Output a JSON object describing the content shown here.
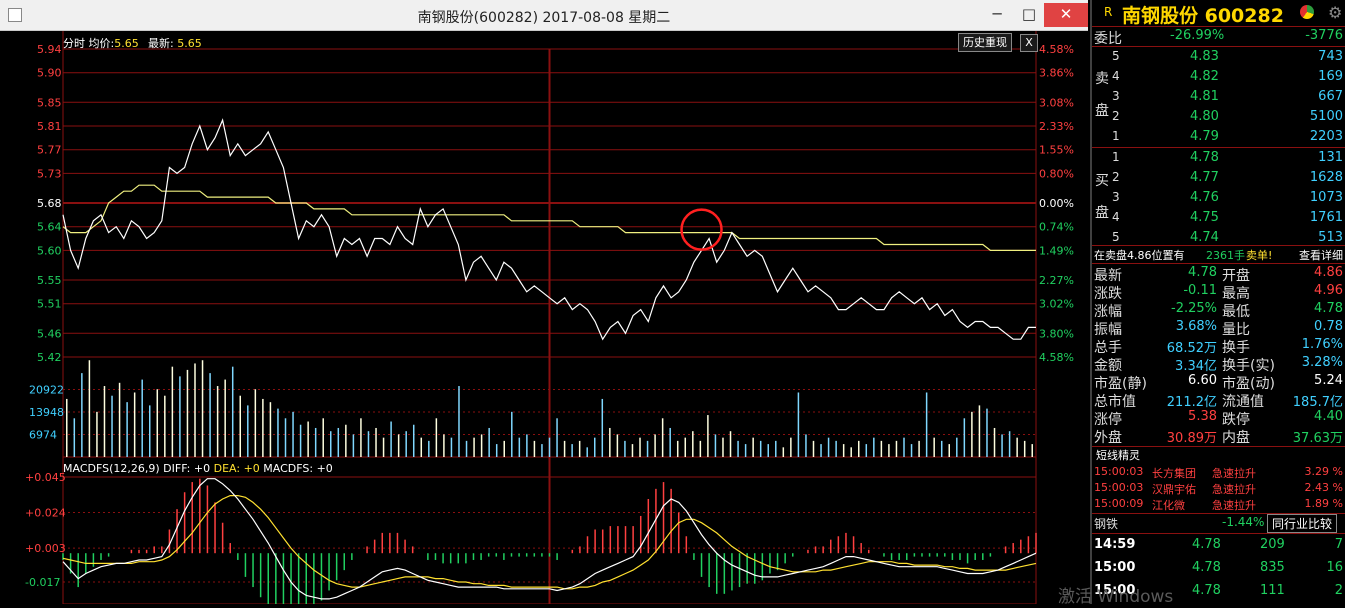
{
  "window": {
    "title": "南钢股份(600282) 2017-08-08 星期二",
    "minimize": "─",
    "maximize": "□",
    "close": "✕"
  },
  "chart_header": {
    "label": "分时 均价:",
    "avg_value": "5.65",
    "latest_label": "最新:",
    "latest_value": "5.65",
    "history_button": "历史重现",
    "close_button": "X"
  },
  "macd_header": {
    "label": "MACDFS(12,26,9)",
    "diff_label": "DIFF: +0",
    "dea_label": "DEA: +0",
    "macd_label": "MACDFS: +0"
  },
  "colors": {
    "up": "#ff4040",
    "down": "#20d060",
    "price_line": "#ffffff",
    "avg_line": "#f0f080",
    "grid": "#8a1010",
    "volume": "#80d8ff"
  },
  "chart_data": [
    {
      "type": "line",
      "name": "price",
      "y_ticks": [
        "5.94",
        "5.90",
        "5.85",
        "5.81",
        "5.77",
        "5.73",
        "5.68",
        "5.64",
        "5.60",
        "5.55",
        "5.51",
        "5.46",
        "5.42"
      ],
      "pct_ticks": [
        "4.58%",
        "3.86%",
        "3.08%",
        "2.33%",
        "1.55%",
        "0.80%",
        "0.00%",
        "0.74%",
        "1.49%",
        "2.27%",
        "3.02%",
        "3.80%",
        "4.58%"
      ],
      "ylim": [
        5.42,
        5.94
      ],
      "prev_close": 5.68,
      "price": [
        5.66,
        5.6,
        5.57,
        5.62,
        5.65,
        5.66,
        5.63,
        5.64,
        5.62,
        5.65,
        5.64,
        5.62,
        5.63,
        5.65,
        5.74,
        5.73,
        5.74,
        5.78,
        5.81,
        5.77,
        5.79,
        5.82,
        5.76,
        5.78,
        5.76,
        5.77,
        5.78,
        5.8,
        5.77,
        5.74,
        5.68,
        5.62,
        5.65,
        5.64,
        5.66,
        5.64,
        5.59,
        5.62,
        5.61,
        5.62,
        5.59,
        5.62,
        5.62,
        5.61,
        5.64,
        5.62,
        5.61,
        5.67,
        5.64,
        5.66,
        5.67,
        5.64,
        5.61,
        5.55,
        5.58,
        5.59,
        5.57,
        5.55,
        5.58,
        5.57,
        5.55,
        5.53,
        5.54,
        5.53,
        5.52,
        5.51,
        5.52,
        5.5,
        5.51,
        5.5,
        5.48,
        5.45,
        5.47,
        5.48,
        5.46,
        5.49,
        5.5,
        5.48,
        5.52,
        5.54,
        5.52,
        5.53,
        5.55,
        5.58,
        5.6,
        5.62,
        5.58,
        5.6,
        5.63,
        5.61,
        5.59,
        5.6,
        5.59,
        5.56,
        5.53,
        5.55,
        5.57,
        5.55,
        5.53,
        5.54,
        5.53,
        5.52,
        5.5,
        5.5,
        5.51,
        5.52,
        5.51,
        5.5,
        5.5,
        5.52,
        5.53,
        5.52,
        5.51,
        5.52,
        5.5,
        5.51,
        5.49,
        5.5,
        5.48,
        5.47,
        5.48,
        5.48,
        5.47,
        5.47,
        5.46,
        5.45,
        5.45,
        5.47,
        5.47
      ],
      "avg": [
        5.64,
        5.63,
        5.63,
        5.63,
        5.64,
        5.65,
        5.68,
        5.69,
        5.7,
        5.7,
        5.71,
        5.71,
        5.71,
        5.7,
        5.7,
        5.7,
        5.7,
        5.7,
        5.7,
        5.69,
        5.69,
        5.69,
        5.69,
        5.69,
        5.69,
        5.69,
        5.69,
        5.69,
        5.68,
        5.68,
        5.68,
        5.68,
        5.68,
        5.67,
        5.67,
        5.67,
        5.67,
        5.67,
        5.66,
        5.66,
        5.66,
        5.66,
        5.66,
        5.66,
        5.66,
        5.66,
        5.66,
        5.66,
        5.66,
        5.66,
        5.66,
        5.66,
        5.66,
        5.66,
        5.66,
        5.66,
        5.66,
        5.66,
        5.66,
        5.65,
        5.65,
        5.65,
        5.65,
        5.65,
        5.65,
        5.65,
        5.65,
        5.65,
        5.64,
        5.64,
        5.64,
        5.64,
        5.64,
        5.64,
        5.63,
        5.63,
        5.63,
        5.63,
        5.63,
        5.63,
        5.63,
        5.63,
        5.63,
        5.63,
        5.63,
        5.63,
        5.63,
        5.63,
        5.63,
        5.62,
        5.62,
        5.62,
        5.62,
        5.62,
        5.62,
        5.62,
        5.62,
        5.62,
        5.62,
        5.62,
        5.62,
        5.62,
        5.62,
        5.62,
        5.62,
        5.62,
        5.62,
        5.62,
        5.61,
        5.61,
        5.61,
        5.61,
        5.61,
        5.61,
        5.61,
        5.61,
        5.61,
        5.61,
        5.61,
        5.61,
        5.61,
        5.61,
        5.6,
        5.6,
        5.6,
        5.6,
        5.6,
        5.6,
        5.6
      ]
    },
    {
      "type": "bar",
      "name": "volume",
      "y_ticks": [
        "20922",
        "13948",
        "6974"
      ],
      "ylim": [
        0,
        31000
      ],
      "values": [
        18000,
        12000,
        26000,
        30000,
        14000,
        22000,
        19000,
        23000,
        17000,
        20000,
        24000,
        16000,
        21000,
        19000,
        28000,
        25000,
        27000,
        29000,
        30000,
        26000,
        22000,
        24000,
        28000,
        19000,
        16000,
        21000,
        18000,
        17000,
        15000,
        12000,
        14000,
        10000,
        11000,
        9000,
        12000,
        8000,
        9000,
        10000,
        7000,
        12000,
        8000,
        9000,
        6000,
        11000,
        7000,
        8000,
        10000,
        6000,
        5000,
        12000,
        7000,
        6000,
        22000,
        5000,
        6000,
        7000,
        9000,
        4000,
        5000,
        14000,
        6000,
        7000,
        5000,
        4000,
        6000,
        12000,
        5000,
        4000,
        5000,
        3000,
        6000,
        18000,
        9000,
        7000,
        5000,
        4000,
        6000,
        5000,
        7000,
        12000,
        9000,
        5000,
        6000,
        8000,
        5000,
        13000,
        7000,
        6000,
        8000,
        5000,
        4000,
        6000,
        5000,
        4000,
        5000,
        3000,
        6000,
        20000,
        7000,
        5000,
        4000,
        6000,
        5000,
        4000,
        3000,
        5000,
        4000,
        6000,
        5000,
        4000,
        5000,
        6000,
        4000,
        5000,
        20000,
        6000,
        5000,
        4000,
        6000,
        12000,
        14000,
        16000,
        15000,
        9000,
        7000,
        8000,
        6000,
        5000,
        4000
      ]
    },
    {
      "type": "line",
      "name": "macd",
      "y_ticks": [
        "+0.045",
        "+0.024",
        "+0.003",
        "-0.017"
      ],
      "ylim": [
        -0.03,
        0.045
      ],
      "diff": [
        -0.005,
        -0.01,
        -0.015,
        -0.012,
        -0.01,
        -0.008,
        -0.007,
        -0.006,
        -0.006,
        -0.005,
        -0.004,
        -0.004,
        -0.003,
        -0.002,
        0.005,
        0.015,
        0.025,
        0.033,
        0.04,
        0.044,
        0.044,
        0.041,
        0.037,
        0.032,
        0.026,
        0.02,
        0.013,
        0.006,
        -0.002,
        -0.01,
        -0.017,
        -0.022,
        -0.025,
        -0.026,
        -0.027,
        -0.027,
        -0.026,
        -0.024,
        -0.022,
        -0.02,
        -0.017,
        -0.014,
        -0.011,
        -0.01,
        -0.009,
        -0.01,
        -0.012,
        -0.014,
        -0.016,
        -0.017,
        -0.018,
        -0.019,
        -0.02,
        -0.02,
        -0.02,
        -0.02,
        -0.02,
        -0.02,
        -0.021,
        -0.021,
        -0.021,
        -0.021,
        -0.021,
        -0.021,
        -0.021,
        -0.022,
        -0.021,
        -0.02,
        -0.018,
        -0.015,
        -0.012,
        -0.01,
        -0.008,
        -0.006,
        -0.004,
        -0.002,
        0.004,
        0.012,
        0.02,
        0.028,
        0.032,
        0.03,
        0.025,
        0.018,
        0.011,
        0.005,
        0.0,
        -0.004,
        -0.007,
        -0.009,
        -0.011,
        -0.013,
        -0.014,
        -0.014,
        -0.014,
        -0.013,
        -0.012,
        -0.011,
        -0.01,
        -0.009,
        -0.008,
        -0.006,
        -0.004,
        -0.002,
        -0.002,
        -0.003,
        -0.004,
        -0.005,
        -0.006,
        -0.007,
        -0.008,
        -0.008,
        -0.008,
        -0.008,
        -0.008,
        -0.008,
        -0.009,
        -0.01,
        -0.011,
        -0.012,
        -0.012,
        -0.012,
        -0.011,
        -0.01,
        -0.008,
        -0.006,
        -0.004,
        -0.002,
        0.0
      ],
      "dea": [
        -0.003,
        -0.004,
        -0.005,
        -0.006,
        -0.006,
        -0.006,
        -0.006,
        -0.006,
        -0.006,
        -0.006,
        -0.005,
        -0.005,
        -0.005,
        -0.004,
        -0.002,
        0.002,
        0.007,
        0.012,
        0.018,
        0.024,
        0.029,
        0.032,
        0.034,
        0.034,
        0.033,
        0.03,
        0.026,
        0.021,
        0.015,
        0.009,
        0.003,
        -0.002,
        -0.006,
        -0.01,
        -0.013,
        -0.016,
        -0.018,
        -0.019,
        -0.02,
        -0.02,
        -0.019,
        -0.018,
        -0.017,
        -0.016,
        -0.015,
        -0.014,
        -0.014,
        -0.014,
        -0.014,
        -0.015,
        -0.015,
        -0.016,
        -0.017,
        -0.017,
        -0.018,
        -0.018,
        -0.019,
        -0.019,
        -0.019,
        -0.02,
        -0.02,
        -0.02,
        -0.02,
        -0.02,
        -0.02,
        -0.02,
        -0.021,
        -0.021,
        -0.02,
        -0.02,
        -0.019,
        -0.017,
        -0.016,
        -0.014,
        -0.012,
        -0.01,
        -0.007,
        -0.004,
        0.001,
        0.007,
        0.013,
        0.018,
        0.02,
        0.02,
        0.018,
        0.015,
        0.012,
        0.008,
        0.004,
        0.001,
        -0.002,
        -0.004,
        -0.006,
        -0.008,
        -0.009,
        -0.01,
        -0.011,
        -0.011,
        -0.011,
        -0.011,
        -0.01,
        -0.01,
        -0.009,
        -0.008,
        -0.007,
        -0.006,
        -0.005,
        -0.005,
        -0.005,
        -0.005,
        -0.006,
        -0.006,
        -0.007,
        -0.007,
        -0.007,
        -0.007,
        -0.008,
        -0.008,
        -0.009,
        -0.009,
        -0.01,
        -0.01,
        -0.01,
        -0.01,
        -0.01,
        -0.009,
        -0.008,
        -0.007,
        -0.006
      ]
    }
  ],
  "quote": {
    "tag": "R",
    "name": "南钢股份 600282",
    "committee": {
      "label": "委比",
      "pct": "-26.99%",
      "diff": "-3776"
    },
    "sell_label": [
      "卖",
      "盘"
    ],
    "buy_label": [
      "买",
      "盘"
    ],
    "sell": [
      {
        "lvl": "5",
        "price": "4.83",
        "vol": "743"
      },
      {
        "lvl": "4",
        "price": "4.82",
        "vol": "169"
      },
      {
        "lvl": "3",
        "price": "4.81",
        "vol": "667"
      },
      {
        "lvl": "2",
        "price": "4.80",
        "vol": "5100"
      },
      {
        "lvl": "1",
        "price": "4.79",
        "vol": "2203"
      }
    ],
    "buy": [
      {
        "lvl": "1",
        "price": "4.78",
        "vol": "131"
      },
      {
        "lvl": "2",
        "price": "4.77",
        "vol": "1628"
      },
      {
        "lvl": "3",
        "price": "4.76",
        "vol": "1073"
      },
      {
        "lvl": "4",
        "price": "4.75",
        "vol": "1761"
      },
      {
        "lvl": "5",
        "price": "4.74",
        "vol": "513"
      }
    ],
    "notice": {
      "text": "在卖盘4.86位置有",
      "amount": "2361手",
      "type": "卖单!",
      "detail": "查看详细"
    },
    "stats": [
      {
        "k1": "最新",
        "v1": "4.78",
        "c1": "green",
        "k2": "开盘",
        "v2": "4.86",
        "c2": "red"
      },
      {
        "k1": "涨跌",
        "v1": "-0.11",
        "c1": "green",
        "k2": "最高",
        "v2": "4.96",
        "c2": "red"
      },
      {
        "k1": "涨幅",
        "v1": "-2.25%",
        "c1": "green",
        "k2": "最低",
        "v2": "4.78",
        "c2": "green"
      },
      {
        "k1": "振幅",
        "v1": "3.68%",
        "c1": "cyan",
        "k2": "量比",
        "v2": "0.78",
        "c2": "cyan"
      },
      {
        "k1": "总手",
        "v1": "68.52万",
        "c1": "cyan",
        "k2": "换手",
        "v2": "1.76%",
        "c2": "cyan"
      },
      {
        "k1": "金额",
        "v1": "3.34亿",
        "c1": "cyan",
        "k2": "换手(实)",
        "v2": "3.28%",
        "c2": "cyan"
      },
      {
        "k1": "市盈(静)",
        "v1": "6.60",
        "c1": "white",
        "k2": "市盈(动)",
        "v2": "5.24",
        "c2": "white"
      },
      {
        "k1": "总市值",
        "v1": "211.2亿",
        "c1": "cyan",
        "k2": "流通值",
        "v2": "185.7亿",
        "c2": "cyan"
      },
      {
        "k1": "涨停",
        "v1": "5.38",
        "c1": "red",
        "k2": "跌停",
        "v2": "4.40",
        "c2": "green"
      },
      {
        "k1": "外盘",
        "v1": "30.89万",
        "c1": "red",
        "k2": "内盘",
        "v2": "37.63万",
        "c2": "green"
      }
    ],
    "alerts_title": "短线精灵",
    "alerts": [
      {
        "time": "15:00:03",
        "name": "长方集团",
        "type": "急速拉升",
        "pct": "3.29 %"
      },
      {
        "time": "15:00:03",
        "name": "汉鼎宇佑",
        "type": "急速拉升",
        "pct": "2.43 %"
      },
      {
        "time": "15:00:09",
        "name": "江化微",
        "type": "急速拉升",
        "pct": "1.89 %"
      }
    ],
    "sector": {
      "name": "钢铁",
      "pct": "-1.44%",
      "button": "同行业比较"
    },
    "ticks": [
      {
        "time": "14:59",
        "price": "4.78",
        "vol": "209",
        "n": "7"
      },
      {
        "time": "15:00",
        "price": "4.78",
        "vol": "835",
        "n": "16"
      },
      {
        "time": "15:00",
        "price": "4.78",
        "vol": "111",
        "n": "2"
      }
    ],
    "watermark": "激活 Windows"
  }
}
